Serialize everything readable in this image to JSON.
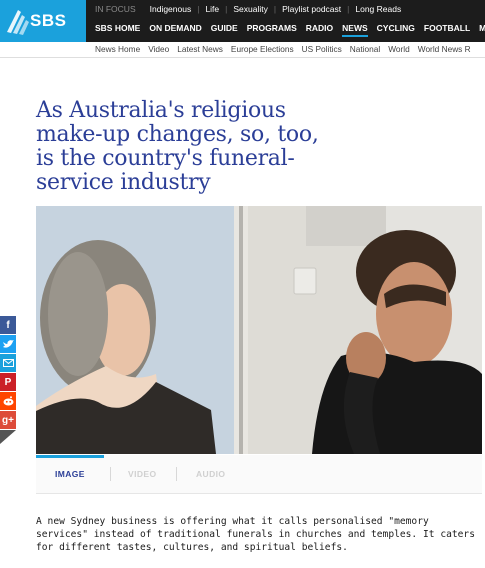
{
  "header": {
    "logo": "SBS",
    "focus_label": "IN FOCUS",
    "focus_links": [
      "Indigenous",
      "Life",
      "Sexuality",
      "Playlist podcast",
      "Long Reads"
    ],
    "main_nav": [
      "SBS HOME",
      "ON DEMAND",
      "GUIDE",
      "PROGRAMS",
      "RADIO",
      "NEWS",
      "CYCLING",
      "FOOTBALL",
      "MO"
    ],
    "active_nav": "NEWS",
    "sub_nav": [
      "News Home",
      "Video",
      "Latest News",
      "Europe Elections",
      "US Politics",
      "National",
      "World",
      "World News R"
    ]
  },
  "article": {
    "headline": "As Australia's religious make-up changes, so, too, is the country's funeral-service industry",
    "media_tabs": [
      "IMAGE",
      "VIDEO",
      "AUDIO"
    ],
    "active_tab": "IMAGE",
    "intro": "A new Sydney business is offering what it calls personalised \"memory services\" instead of traditional funerals in churches and temples. It caters for different tastes, cultures, and spiritual beliefs."
  },
  "share_buttons": [
    "facebook-icon",
    "twitter-icon",
    "email-icon",
    "pinterest-icon",
    "reddit-icon",
    "google-plus-icon"
  ],
  "colors": {
    "brand_blue": "#1ba1dc",
    "headline": "#2b3e97",
    "header_bg": "#1c1c1c"
  }
}
